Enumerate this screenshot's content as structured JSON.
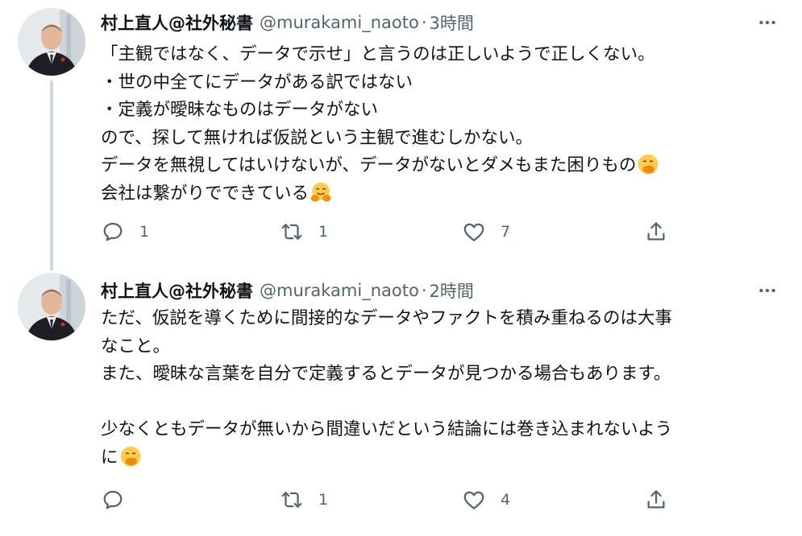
{
  "tweets": [
    {
      "author": {
        "name": "村上直人@社外秘書",
        "handle": "@murakami_naoto"
      },
      "separator": "·",
      "time": "3時間",
      "lines": [
        "「主観ではなく、データで示せ」と言うのは正しいようで正しくない。",
        "・世の中全てにデータがある訳ではない",
        "・定義が曖昧なものはデータがない",
        "ので、探して無ければ仮説という主観で進むしかない。",
        "データを無視してはいけないが、データがないとダメもまた困りもの",
        "会社は繋がりでできている"
      ],
      "line_emojis": {
        "4": "face-with-hand-over-mouth",
        "5": "hugging-face"
      },
      "counts": {
        "replies": "1",
        "retweets": "1",
        "likes": "7"
      }
    },
    {
      "author": {
        "name": "村上直人@社外秘書",
        "handle": "@murakami_naoto"
      },
      "separator": "·",
      "time": "2時間",
      "lines": [
        "ただ、仮説を導くために間接的なデータやファクトを積み重ねるのは大事",
        "なこと。",
        "また、曖昧な言葉を自分で定義するとデータが見つかる場合もあります。",
        "",
        "少なくともデータが無いから間違いだという結論には巻き込まれないよう",
        "に"
      ],
      "line_emojis": {
        "5": "face-with-hand-over-mouth"
      },
      "counts": {
        "replies": "",
        "retweets": "1",
        "likes": "4"
      }
    }
  ],
  "icons": {
    "more": "more-horizontal-icon",
    "reply": "reply-icon",
    "retweet": "retweet-icon",
    "like": "heart-icon",
    "share": "share-icon"
  },
  "colors": {
    "text": "#0f1419",
    "secondary": "#536471",
    "thread_line": "#cfd9de",
    "background": "#ffffff"
  }
}
